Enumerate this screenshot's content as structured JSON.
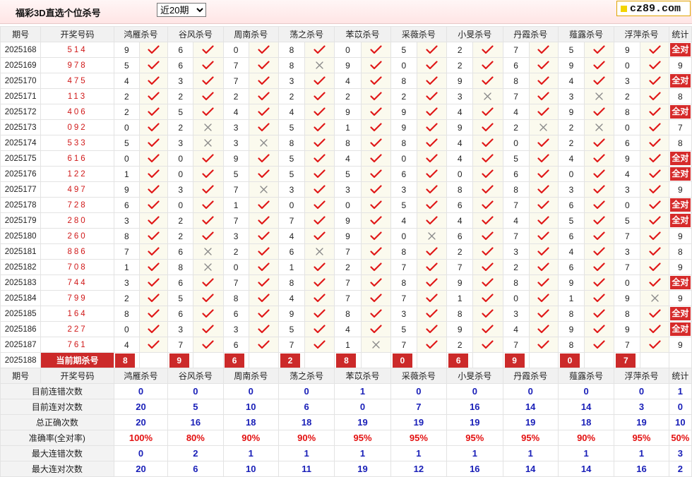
{
  "header": {
    "title": "福彩3D直选个位杀号",
    "period_selected": "近20期",
    "logo_text": "cz89.com"
  },
  "columns": {
    "issue": "期号",
    "draw": "开奖号码",
    "predictors": [
      "鸿雁杀号",
      "谷风杀号",
      "周南杀号",
      "荡之杀号",
      "苯苡杀号",
      "采薇杀号",
      "小旻杀号",
      "丹霞杀号",
      "薤露杀号",
      "浮萍杀号"
    ],
    "stat": "统计"
  },
  "rows": [
    {
      "issue": "2025168",
      "draw": "514",
      "vals": [
        "9",
        "6",
        "0",
        "8",
        "0",
        "5",
        "2",
        "7",
        "5",
        "9"
      ],
      "ok": [
        true,
        true,
        true,
        true,
        true,
        true,
        true,
        true,
        true,
        true
      ],
      "stat": "全对"
    },
    {
      "issue": "2025169",
      "draw": "978",
      "vals": [
        "5",
        "6",
        "7",
        "8",
        "9",
        "0",
        "2",
        "6",
        "9",
        "0"
      ],
      "ok": [
        true,
        true,
        true,
        false,
        true,
        true,
        true,
        true,
        true,
        true
      ],
      "stat": "9"
    },
    {
      "issue": "2025170",
      "draw": "475",
      "vals": [
        "4",
        "3",
        "7",
        "3",
        "4",
        "8",
        "9",
        "8",
        "4",
        "3"
      ],
      "ok": [
        true,
        true,
        true,
        true,
        true,
        true,
        true,
        true,
        true,
        true
      ],
      "stat": "全对"
    },
    {
      "issue": "2025171",
      "draw": "113",
      "vals": [
        "2",
        "2",
        "2",
        "2",
        "2",
        "2",
        "3",
        "7",
        "3",
        "2"
      ],
      "ok": [
        true,
        true,
        true,
        true,
        true,
        true,
        false,
        true,
        false,
        true
      ],
      "stat": "8"
    },
    {
      "issue": "2025172",
      "draw": "406",
      "vals": [
        "2",
        "5",
        "4",
        "4",
        "9",
        "9",
        "4",
        "4",
        "9",
        "8"
      ],
      "ok": [
        true,
        true,
        true,
        true,
        true,
        true,
        true,
        true,
        true,
        true
      ],
      "stat": "全对"
    },
    {
      "issue": "2025173",
      "draw": "092",
      "vals": [
        "0",
        "2",
        "3",
        "5",
        "1",
        "9",
        "9",
        "2",
        "2",
        "0"
      ],
      "ok": [
        true,
        false,
        true,
        true,
        true,
        true,
        true,
        false,
        false,
        true
      ],
      "stat": "7"
    },
    {
      "issue": "2025174",
      "draw": "533",
      "vals": [
        "5",
        "3",
        "3",
        "8",
        "8",
        "8",
        "4",
        "0",
        "2",
        "6"
      ],
      "ok": [
        true,
        false,
        false,
        true,
        true,
        true,
        true,
        true,
        true,
        true
      ],
      "stat": "8"
    },
    {
      "issue": "2025175",
      "draw": "616",
      "vals": [
        "0",
        "0",
        "9",
        "5",
        "4",
        "0",
        "4",
        "5",
        "4",
        "9"
      ],
      "ok": [
        true,
        true,
        true,
        true,
        true,
        true,
        true,
        true,
        true,
        true
      ],
      "stat": "全对"
    },
    {
      "issue": "2025176",
      "draw": "122",
      "vals": [
        "1",
        "0",
        "5",
        "5",
        "5",
        "6",
        "0",
        "6",
        "0",
        "4"
      ],
      "ok": [
        true,
        true,
        true,
        true,
        true,
        true,
        true,
        true,
        true,
        true
      ],
      "stat": "全对"
    },
    {
      "issue": "2025177",
      "draw": "497",
      "vals": [
        "9",
        "3",
        "7",
        "3",
        "3",
        "3",
        "8",
        "8",
        "3",
        "3"
      ],
      "ok": [
        true,
        true,
        false,
        true,
        true,
        true,
        true,
        true,
        true,
        true
      ],
      "stat": "9"
    },
    {
      "issue": "2025178",
      "draw": "728",
      "vals": [
        "6",
        "0",
        "1",
        "0",
        "0",
        "5",
        "6",
        "7",
        "6",
        "0"
      ],
      "ok": [
        true,
        true,
        true,
        true,
        true,
        true,
        true,
        true,
        true,
        true
      ],
      "stat": "全对"
    },
    {
      "issue": "2025179",
      "draw": "280",
      "vals": [
        "3",
        "2",
        "7",
        "7",
        "9",
        "4",
        "4",
        "4",
        "5",
        "5"
      ],
      "ok": [
        true,
        true,
        true,
        true,
        true,
        true,
        true,
        true,
        true,
        true
      ],
      "stat": "全对"
    },
    {
      "issue": "2025180",
      "draw": "260",
      "vals": [
        "8",
        "2",
        "3",
        "4",
        "9",
        "0",
        "6",
        "7",
        "6",
        "7"
      ],
      "ok": [
        true,
        true,
        true,
        true,
        true,
        false,
        true,
        true,
        true,
        true
      ],
      "stat": "9"
    },
    {
      "issue": "2025181",
      "draw": "886",
      "vals": [
        "7",
        "6",
        "2",
        "6",
        "7",
        "8",
        "2",
        "3",
        "4",
        "3"
      ],
      "ok": [
        true,
        false,
        true,
        false,
        true,
        true,
        true,
        true,
        true,
        true
      ],
      "stat": "8"
    },
    {
      "issue": "2025182",
      "draw": "708",
      "vals": [
        "1",
        "8",
        "0",
        "1",
        "2",
        "7",
        "7",
        "2",
        "6",
        "7"
      ],
      "ok": [
        true,
        false,
        true,
        true,
        true,
        true,
        true,
        true,
        true,
        true
      ],
      "stat": "9"
    },
    {
      "issue": "2025183",
      "draw": "744",
      "vals": [
        "3",
        "6",
        "7",
        "8",
        "7",
        "8",
        "9",
        "8",
        "9",
        "0"
      ],
      "ok": [
        true,
        true,
        true,
        true,
        true,
        true,
        true,
        true,
        true,
        true
      ],
      "stat": "全对"
    },
    {
      "issue": "2025184",
      "draw": "799",
      "vals": [
        "2",
        "5",
        "8",
        "4",
        "7",
        "7",
        "1",
        "0",
        "1",
        "9"
      ],
      "ok": [
        true,
        true,
        true,
        true,
        true,
        true,
        true,
        true,
        true,
        false
      ],
      "stat": "9"
    },
    {
      "issue": "2025185",
      "draw": "164",
      "vals": [
        "8",
        "6",
        "6",
        "9",
        "8",
        "3",
        "8",
        "3",
        "8",
        "8"
      ],
      "ok": [
        true,
        true,
        true,
        true,
        true,
        true,
        true,
        true,
        true,
        true
      ],
      "stat": "全对"
    },
    {
      "issue": "2025186",
      "draw": "227",
      "vals": [
        "0",
        "3",
        "3",
        "5",
        "4",
        "5",
        "9",
        "4",
        "9",
        "9"
      ],
      "ok": [
        true,
        true,
        true,
        true,
        true,
        true,
        true,
        true,
        true,
        true
      ],
      "stat": "全对"
    },
    {
      "issue": "2025187",
      "draw": "761",
      "vals": [
        "4",
        "7",
        "6",
        "7",
        "1",
        "7",
        "2",
        "7",
        "8",
        "7"
      ],
      "ok": [
        true,
        true,
        true,
        true,
        false,
        true,
        true,
        true,
        true,
        true
      ],
      "stat": "9"
    }
  ],
  "current": {
    "issue": "2025188",
    "label": "当前期杀号",
    "vals": [
      "8",
      "9",
      "6",
      "2",
      "8",
      "0",
      "6",
      "9",
      "0",
      "7"
    ]
  },
  "stats": [
    {
      "label": "目前连错次数",
      "vals": [
        "0",
        "0",
        "0",
        "0",
        "1",
        "0",
        "0",
        "0",
        "0",
        "0",
        "1"
      ],
      "color": "blue"
    },
    {
      "label": "目前连对次数",
      "vals": [
        "20",
        "5",
        "10",
        "6",
        "0",
        "7",
        "16",
        "14",
        "14",
        "3",
        "0"
      ],
      "color": "blue"
    },
    {
      "label": "总正确次数",
      "vals": [
        "20",
        "16",
        "18",
        "18",
        "19",
        "19",
        "19",
        "19",
        "18",
        "19",
        "10"
      ],
      "color": "blue"
    },
    {
      "label": "准确率(全对率)",
      "vals": [
        "100%",
        "80%",
        "90%",
        "90%",
        "95%",
        "95%",
        "95%",
        "95%",
        "90%",
        "95%",
        "50%"
      ],
      "color": "red"
    },
    {
      "label": "最大连错次数",
      "vals": [
        "0",
        "2",
        "1",
        "1",
        "1",
        "1",
        "1",
        "1",
        "1",
        "1",
        "3"
      ],
      "color": "blue"
    },
    {
      "label": "最大连对次数",
      "vals": [
        "20",
        "6",
        "10",
        "11",
        "19",
        "12",
        "16",
        "14",
        "14",
        "16",
        "2"
      ],
      "color": "blue"
    }
  ],
  "colors": {
    "accent_red": "#cc2a2a",
    "check_red": "#e01818",
    "stat_blue": "#1a20b8",
    "cross_gray": "#888888"
  },
  "icons": {
    "ok": "check-icon",
    "miss": "cross-icon"
  }
}
